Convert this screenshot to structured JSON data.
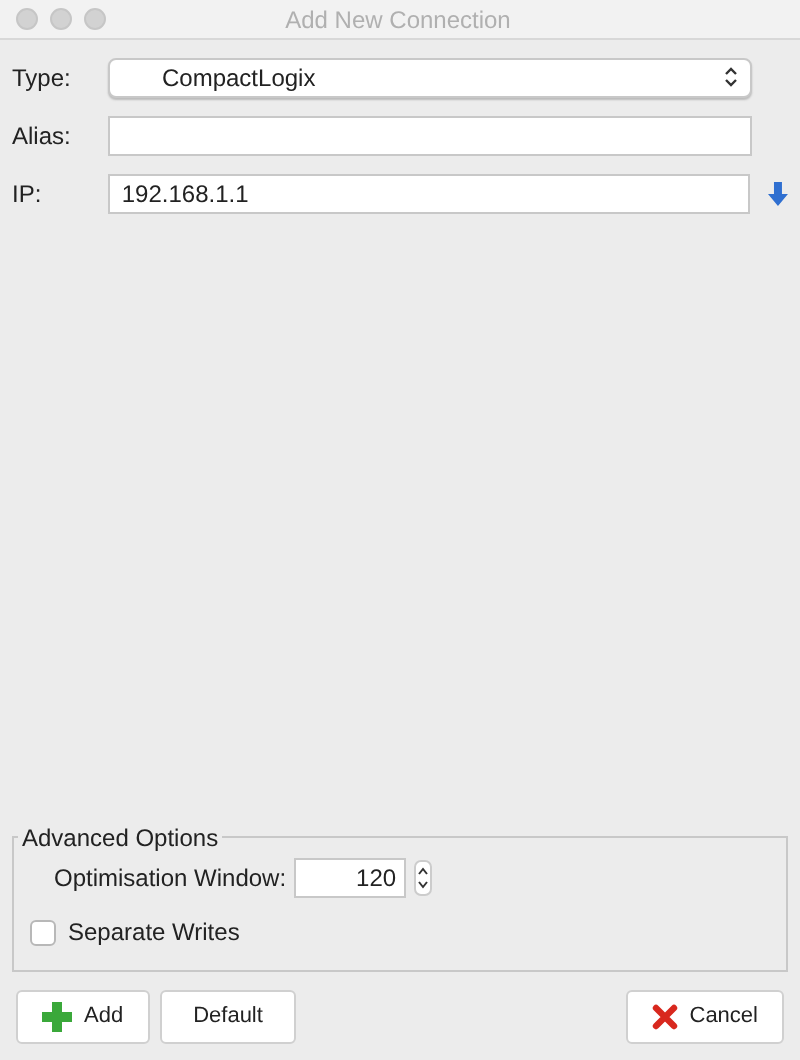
{
  "window": {
    "title": "Add New Connection"
  },
  "fields": [
    {
      "kind": "select",
      "label": "Type:",
      "value": "CompactLogix"
    },
    {
      "kind": "text",
      "label": "Alias:"
    },
    {
      "kind": "text",
      "label": "IP:",
      "value": "192.168.1.1",
      "action": true
    }
  ],
  "advanced": {
    "title": "Advanced Options",
    "window_label": "Optimisation Window:",
    "window_value": "120",
    "separate_writes": {
      "label": "Separate Writes",
      "checked": false
    }
  },
  "buttons": [
    {
      "kind": "add",
      "label": "Add"
    },
    {
      "kind": "plain",
      "label": "Default"
    },
    {
      "kind": "cancel",
      "label": "Cancel"
    }
  ]
}
